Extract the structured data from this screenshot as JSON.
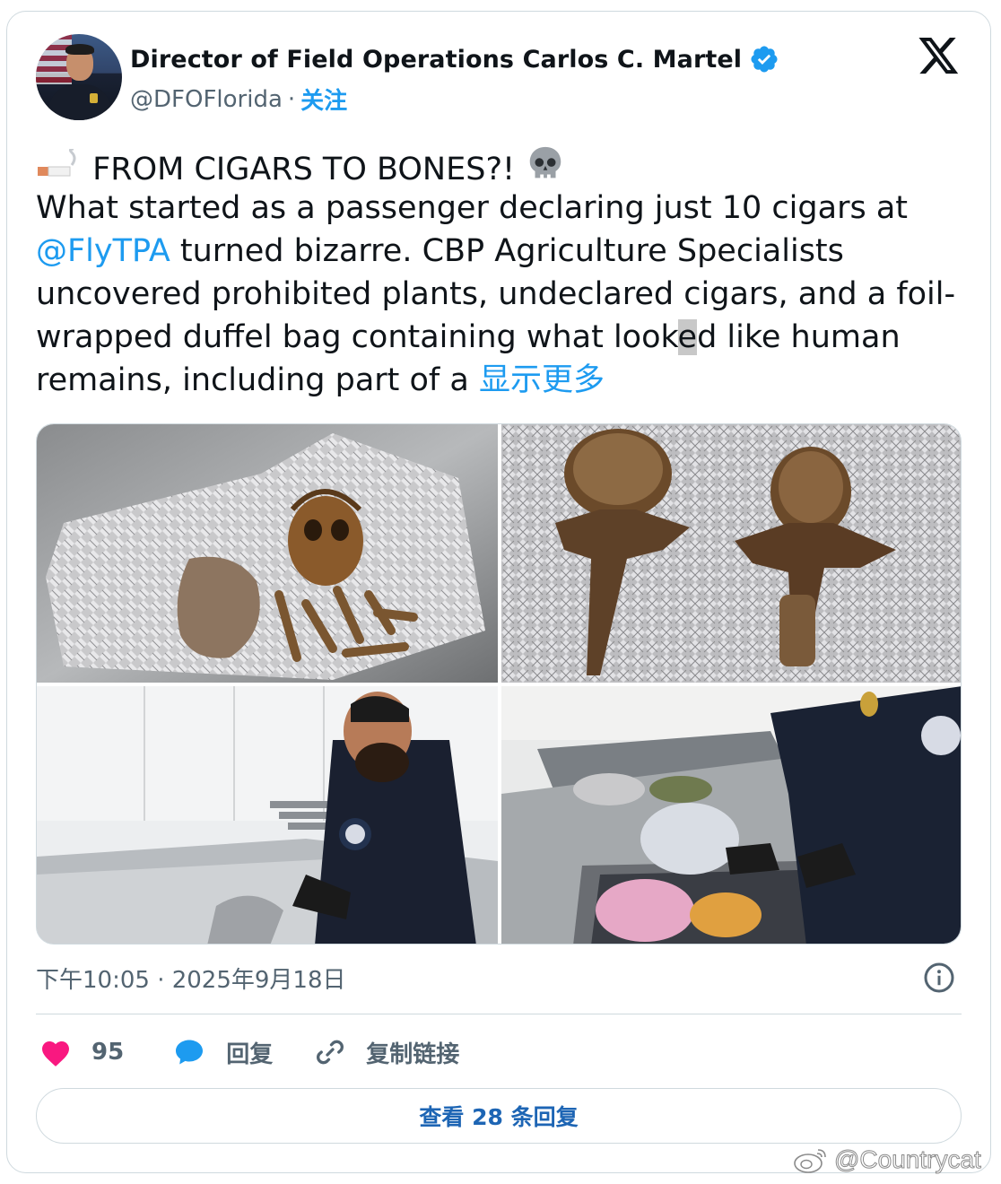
{
  "author": {
    "display_name": "Director of Field Operations Carlos C. Martel",
    "handle": "@DFOFlorida",
    "separator": "·",
    "follow_label": "关注"
  },
  "tweet": {
    "lines": [
      {
        "segments": [
          {
            "t": " FROM CIGARS TO BONES?! ",
            "k": "text"
          }
        ]
      },
      {
        "segments": [
          {
            "t": "What started as a passenger declaring just 10 cigars at",
            "k": "text"
          }
        ]
      },
      {
        "segments": [
          {
            "t": "@FlyTPA",
            "k": "mention"
          },
          {
            "t": " turned bizarre. CBP Agriculture Specialists",
            "k": "text"
          }
        ]
      },
      {
        "segments": [
          {
            "t": "uncovered prohibited plants, undeclared cigars, and a foil-",
            "k": "text"
          }
        ]
      },
      {
        "segments": [
          {
            "t": "wrapped duffel bag containing what look",
            "k": "text"
          },
          {
            "t": "e",
            "k": "highlight"
          },
          {
            "t": "d like human",
            "k": "text"
          }
        ]
      },
      {
        "segments": [
          {
            "t": "remains, including part of a ",
            "k": "text"
          },
          {
            "t": "显示更多",
            "k": "show-more"
          }
        ]
      }
    ],
    "emoji_start": "cigarette-icon",
    "emoji_end": "skull-icon"
  },
  "media": {
    "photos": [
      {
        "name": "photo-skull-and-bones-on-foil"
      },
      {
        "name": "photo-vertebrae-on-foil"
      },
      {
        "name": "photo-officer-inspecting-items"
      },
      {
        "name": "photo-officer-searching-suitcase"
      }
    ]
  },
  "meta": {
    "timestamp": "下午10:05 · 2025年9月18日"
  },
  "actions": {
    "like_count": "95",
    "reply_label": "回复",
    "copy_link_label": "复制链接"
  },
  "replies_button": "查看 28 条回复",
  "watermark": "@Countrycat",
  "colors": {
    "accent": "#1d9bf0",
    "like": "#f91880",
    "secondary_text": "#536471",
    "border": "#cfd9de"
  }
}
